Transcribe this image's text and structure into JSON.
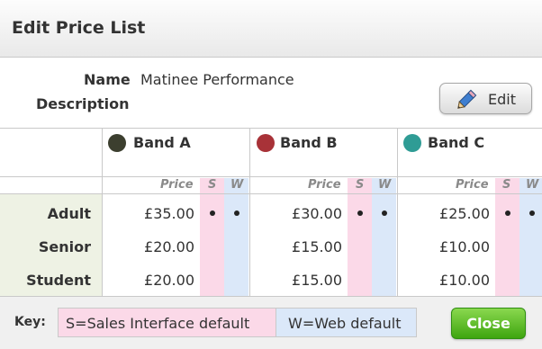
{
  "dialog": {
    "title": "Edit Price List"
  },
  "info": {
    "name_label": "Name",
    "name_value": "Matinee Performance",
    "description_label": "Description",
    "edit_label": "Edit"
  },
  "table": {
    "subheaders": {
      "price": "Price",
      "s": "S",
      "w": "W"
    },
    "bands": [
      {
        "name": "Band A",
        "color": "#3c3f2f"
      },
      {
        "name": "Band B",
        "color": "#a83238"
      },
      {
        "name": "Band C",
        "color": "#2f9c95"
      }
    ],
    "rows": [
      {
        "label": "Adult",
        "prices": [
          "£35.00",
          "£30.00",
          "£25.00"
        ],
        "sales_default": true,
        "web_default": true
      },
      {
        "label": "Senior",
        "prices": [
          "£20.00",
          "£15.00",
          "£10.00"
        ],
        "sales_default": false,
        "web_default": false
      },
      {
        "label": "Student",
        "prices": [
          "£20.00",
          "£15.00",
          "£10.00"
        ],
        "sales_default": false,
        "web_default": false
      }
    ]
  },
  "key": {
    "label": "Key:",
    "sales": "S=Sales Interface default",
    "web": "W=Web default"
  },
  "actions": {
    "close_label": "Close"
  },
  "colors": {
    "sales_highlight": "#fbd9e8",
    "web_highlight": "#dbe8f9",
    "row_label_bg": "#eef2e4",
    "close_button": "#4cae1b"
  }
}
